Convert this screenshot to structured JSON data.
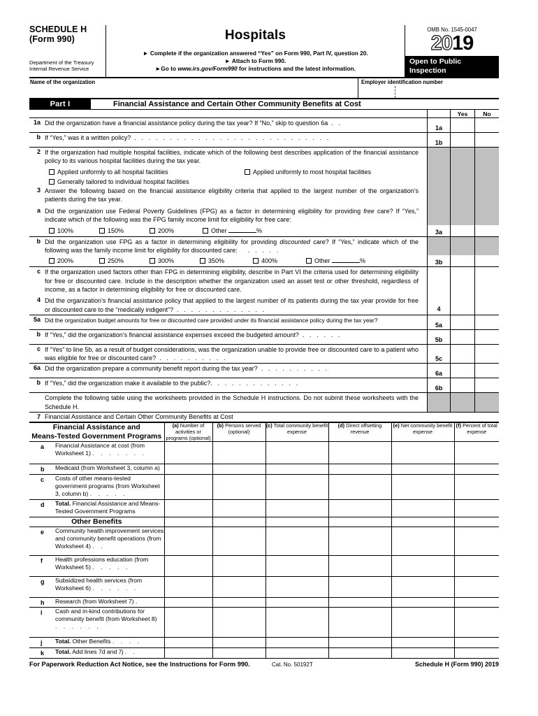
{
  "header": {
    "schedule_name": "SCHEDULE H",
    "form_name": "(Form 990)",
    "department_line1": "Department of the Treasury",
    "department_line2": "Internal Revenue Service",
    "title": "Hospitals",
    "instruction_1": "Complete if the organization answered “Yes” on Form 990, Part IV, question 20.",
    "instruction_2": "Attach to Form 990.",
    "instruction_3a": "Go to ",
    "instruction_3b": "www.irs.gov/Form990",
    "instruction_3c": " for instructions and the latest information.",
    "omb": "OMB No. 1545-0047",
    "year_outline": "20",
    "year_solid": "19",
    "open_to_public_l1": "Open to Public",
    "open_to_public_l2": "Inspection"
  },
  "entity": {
    "name_label": "Name of the organization",
    "name_value": "",
    "ein_label": "Employer identification number",
    "ein_value": ""
  },
  "part": {
    "number": "Part I",
    "title": "Financial Assistance and Certain Other Community Benefits at Cost"
  },
  "yesno": {
    "yes": "Yes",
    "no": "No"
  },
  "questions": {
    "q1a_num": "1a",
    "q1a_text": "Did the organization have a financial assistance policy during the tax year? If “No,” skip to question 6a",
    "q1a_key": "1a",
    "q1b_num": "b",
    "q1b_text": "If “Yes,” was it a written policy?",
    "q1b_key": "1b",
    "q2_num": "2",
    "q2_text": "If the organization had multiple hospital facilities, indicate which of the following best describes application of the financial assistance policy to its various hospital facilities during the tax year.",
    "q2_opt1": "Applied uniformly to all hospital facilities",
    "q2_opt2": "Applied uniformly to most hospital facilities",
    "q2_opt3": "Generally tailored to individual hospital facilities",
    "q3_num": "3",
    "q3_text": "Answer the following based on the financial assistance eligibility criteria that applied to the largest number of the organization's patients during the tax year.",
    "q3a_num": "a",
    "q3a_text_1": "Did the organization use Federal Poverty Guidelines (FPG) as a factor in determining eligibility for providing ",
    "q3a_text_em": "free",
    "q3a_text_2": " care? If “Yes,” indicate which of the following was the FPG family income limit for eligibility for free care:",
    "q3a_key": "3a",
    "q3a_opts": [
      "100%",
      "150%",
      "200%",
      "Other"
    ],
    "q3a_other_suffix": "%",
    "q3b_num": "b",
    "q3b_text_1": "Did the organization use FPG as a factor in determining eligibility for providing ",
    "q3b_text_em": "discounted",
    "q3b_text_2": " care? If “Yes,” indicate which of the following was the family income limit for eligibility for discounted care:",
    "q3b_key": "3b",
    "q3b_opts": [
      "200%",
      "250%",
      "300%",
      "350%",
      "400%",
      "Other"
    ],
    "q3b_other_suffix": "%",
    "q3c_num": "c",
    "q3c_text": "If the organization used factors other than FPG in determining eligibility, describe in Part VI the criteria used for determining eligibility for free or discounted care. Include in the description whether the organization used an asset test or other threshold, regardless of income, as a factor in determining eligibility for free or discounted care.",
    "q4_num": "4",
    "q4_text": "Did the organization’s financial assistance policy that applied to the largest number of its patients during the tax year provide for free or discounted care to the “medically indigent”?",
    "q4_key": "4",
    "q5a_num": "5a",
    "q5a_text": "Did the organization budget amounts for free or discounted care provided under its financial assistance policy during the tax year?",
    "q5a_key": "5a",
    "q5b_num": "b",
    "q5b_text": "If “Yes,” did the organization’s financial assistance expenses exceed the budgeted amount?",
    "q5b_key": "5b",
    "q5c_num": "c",
    "q5c_text": "If “Yes” to line 5b, as a result of budget considerations, was the organization unable to provide free or discounted care to a patient who was eligible for free or discounted care?",
    "q5c_key": "5c",
    "q6a_num": "6a",
    "q6a_text": "Did the organization prepare a community benefit report during the tax year?",
    "q6a_key": "6a",
    "q6b_num": "b",
    "q6b_text": "If “Yes,” did the organization make it available to the public?",
    "q6b_key": "6b",
    "q6_note": "Complete the following table using the worksheets provided in the Schedule H instructions. Do not submit these worksheets with the Schedule H."
  },
  "line7": {
    "num": "7",
    "title": "Financial Assistance and Certain Other Community Benefits at Cost",
    "col_stub_l1": "Financial Assistance and",
    "col_stub_l2": "Means-Tested Government Programs",
    "columns": [
      {
        "tag": "(a)",
        "text": " Number of activities or programs (optional)"
      },
      {
        "tag": "(b)",
        "text": " Persons served (optional)"
      },
      {
        "tag": "(c)",
        "text": " Total community benefit expense"
      },
      {
        "tag": "(d)",
        "text": " Direct offsetting revenue"
      },
      {
        "tag": "(e)",
        "text": " Net community benefit expense"
      },
      {
        "tag": "(f)",
        "text": " Percent of total expense"
      }
    ],
    "subheader": "Other Benefits",
    "rows": [
      {
        "letter": "a",
        "label": "Financial Assistance at cost (from Worksheet 1)",
        "dots": ". . . . . . .",
        "bold": ""
      },
      {
        "letter": "b",
        "label": "Medicaid (from Worksheet 3, column a)",
        "dots": "",
        "bold": ""
      },
      {
        "letter": "c",
        "label": "Costs of other means-tested government programs (from Worksheet 3, column b)",
        "dots": ". . . . .",
        "bold": ""
      },
      {
        "letter": "d",
        "label": "Financial Assistance and Means-Tested Government Programs",
        "dots": "",
        "bold": "Total."
      },
      {
        "letter": "e",
        "label": "Community health improvement services and community benefit operations (from Worksheet 4)",
        "dots": ". .",
        "bold": ""
      },
      {
        "letter": "f",
        "label": "Health professions education (from Worksheet 5)",
        "dots": ". . . . .",
        "bold": ""
      },
      {
        "letter": "g",
        "label": "Subsidized health services (from Worksheet 6)",
        "dots": ". . . . . .",
        "bold": ""
      },
      {
        "letter": "h",
        "label": "Research (from Worksheet 7)",
        "dots": ".",
        "bold": ""
      },
      {
        "letter": "i",
        "label": "Cash and in-kind contributions for community benefit (from Worksheet 8)",
        "dots": ". . . . . .",
        "bold": ""
      },
      {
        "letter": "j",
        "label": "Other Benefits",
        "dots": ". . . .",
        "bold": "Total."
      },
      {
        "letter": "k",
        "label": "Add lines 7d and 7j",
        "dots": ". .",
        "bold": "Total."
      }
    ]
  },
  "footer": {
    "paperwork": "For Paperwork Reduction Act Notice, see the Instructions for Form 990.",
    "cat": "Cat. No. 50192T",
    "formid": "Schedule H (Form 990) 2019"
  }
}
